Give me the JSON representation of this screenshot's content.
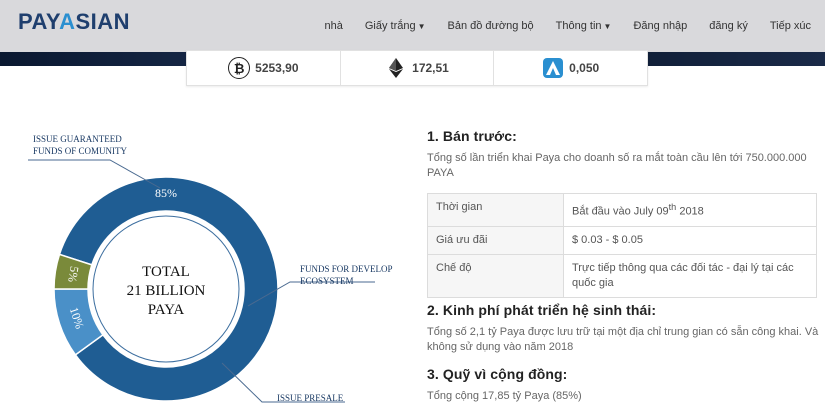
{
  "brand": {
    "logo_text_1": "PAY",
    "logo_text_2": "A",
    "logo_text_3": "SIAN"
  },
  "nav": {
    "items": [
      "nhà",
      "Giấy trắng",
      "Bản đồ đường bộ",
      "Thông tin",
      "Đăng nhập",
      "đăng ký",
      "Tiếp xúc"
    ]
  },
  "ticker": {
    "btc": "5253,90",
    "eth": "172,51",
    "paya": "0,050",
    "icons": [
      "bitcoin-icon",
      "ethereum-icon",
      "payasian-coin-icon"
    ]
  },
  "colors": {
    "primary": "#1f5d93",
    "secondary": "#4a90c8",
    "presale": "#7a8a3a",
    "accent": "#2a8fd0"
  },
  "chart_data": {
    "type": "pie",
    "categories": [
      "ISSUE GUARANTEED FUNDS OF COMUNITY",
      "FUNDS FOR DEVELOP ECOSYSTEM",
      "ISSUE PRESALE"
    ],
    "values": [
      85,
      10,
      5
    ],
    "labels": [
      "85%",
      "10%",
      "5%"
    ],
    "center_text": [
      "TOTAL",
      "21 BILLION",
      "PAYA"
    ]
  },
  "sections": {
    "presale": {
      "title": "1. Bán trước:",
      "desc": "Tổng số lần triển khai Paya cho doanh số ra mắt toàn cầu lên tới 750.000.000 PAYA",
      "rows": [
        {
          "k": "Thời gian",
          "v_pre": "Bắt đầu vào July 09",
          "v_sup": "th",
          "v_post": " 2018"
        },
        {
          "k": "Giá ưu đãi",
          "v": "$ 0.03 - $ 0.05"
        },
        {
          "k": "Chế độ",
          "v": "Trực tiếp thông qua các đối tác - đại lý tại các quốc gia"
        }
      ]
    },
    "ecosystem": {
      "title": "2. Kinh phí phát triển hệ sinh thái:",
      "desc": "Tổng số 2,1 tỷ Paya được lưu trữ tại một địa chỉ trung gian có sẵn công khai. Và không sử dụng vào năm 2018"
    },
    "community": {
      "title": "3. Quỹ vì cộng đồng:",
      "desc": "Tổng cộng 17,85 tỷ Paya (85%)"
    }
  }
}
